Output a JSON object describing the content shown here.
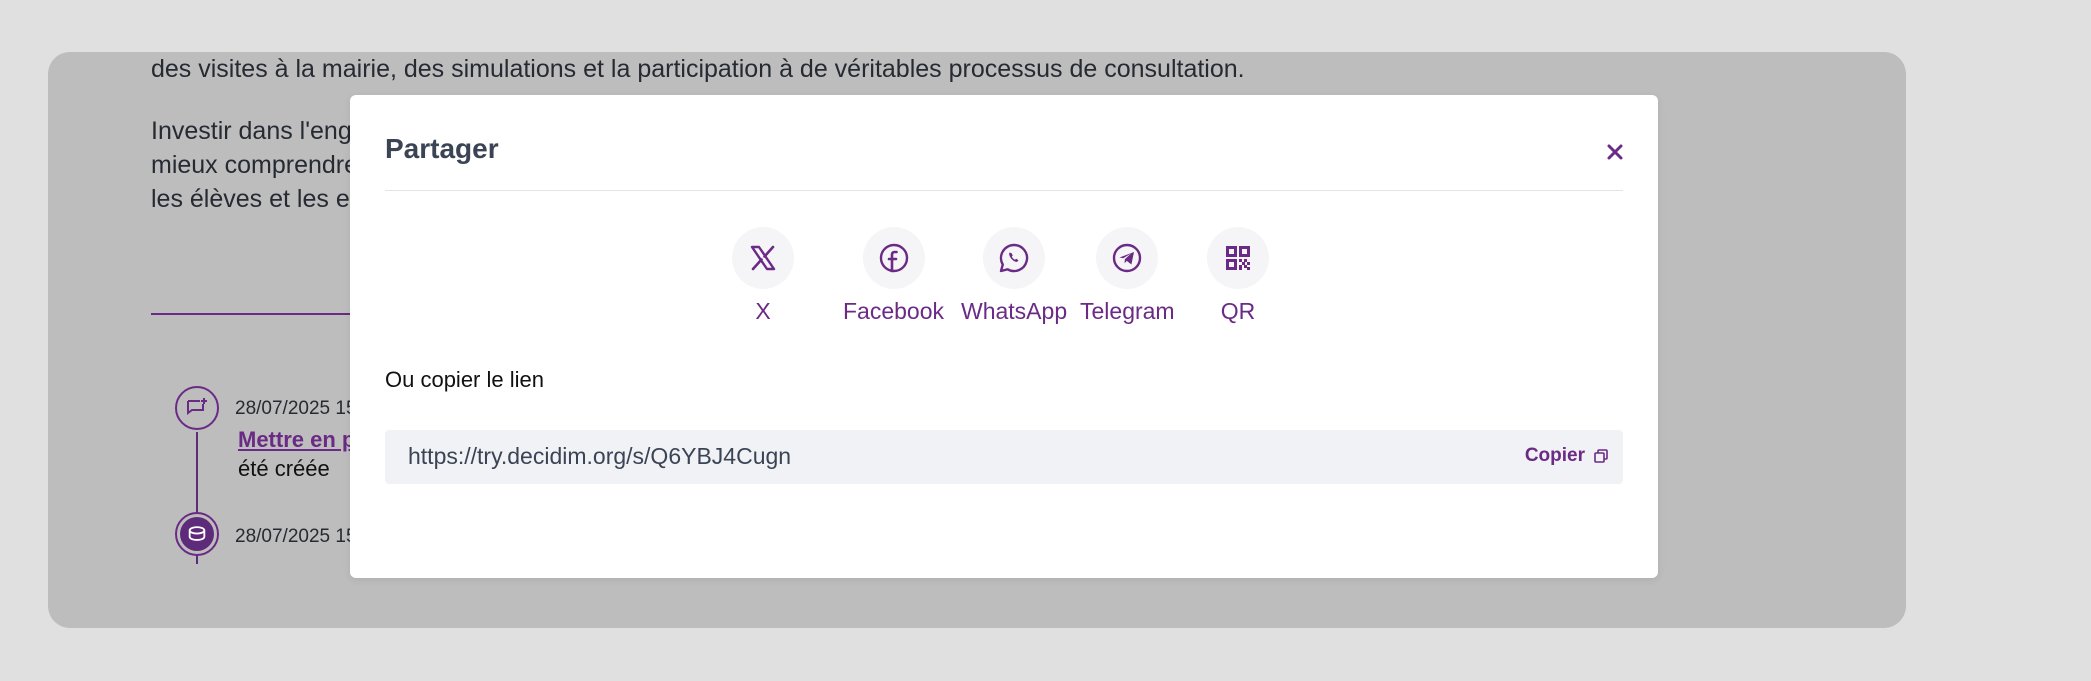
{
  "background": {
    "line1": "des visites à la mairie, des simulations et la participation à de véritables processus de consultation.",
    "para": [
      "Investir dans l'eng",
      "mieux comprendre",
      "les élèves et les en"
    ],
    "timeline": [
      {
        "date": "28/07/2025 15",
        "link": "Mettre en p",
        "sub": "été créée"
      },
      {
        "date": "28/07/2025 15"
      }
    ]
  },
  "modal": {
    "title": "Partager",
    "close_icon": "close-icon",
    "share_options": [
      {
        "label": "X",
        "icon": "x-logo-icon"
      },
      {
        "label": "Facebook",
        "icon": "facebook-icon"
      },
      {
        "label": "WhatsApp",
        "icon": "whatsapp-icon"
      },
      {
        "label": "Telegram",
        "icon": "telegram-icon"
      },
      {
        "label": "QR",
        "icon": "qr-code-icon"
      }
    ],
    "copy_heading": "Ou copier le lien",
    "url": "https://try.decidim.org/s/Q6YBJ4Cugn",
    "copy_label": "Copier",
    "copy_icon": "copy-icon"
  },
  "colors": {
    "accent": "#6a2a85",
    "page_bg": "#e0e0e0",
    "overlay_card": "#bdbdbd",
    "title_text": "#3a4454"
  }
}
